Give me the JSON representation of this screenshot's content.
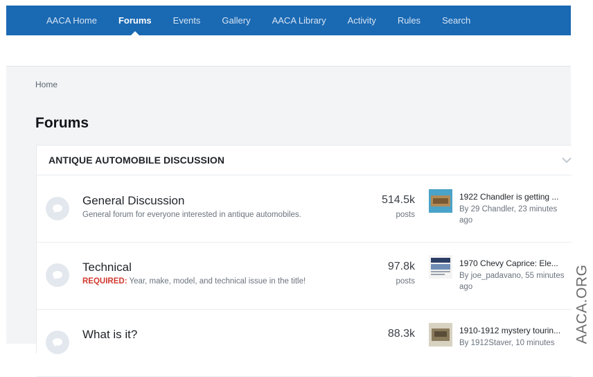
{
  "nav": {
    "items": [
      {
        "label": "AACA Home"
      },
      {
        "label": "Forums",
        "active": true
      },
      {
        "label": "Events"
      },
      {
        "label": "Gallery"
      },
      {
        "label": "AACA Library"
      },
      {
        "label": "Activity"
      },
      {
        "label": "Rules"
      },
      {
        "label": "Search"
      }
    ]
  },
  "breadcrumb": {
    "home": "Home"
  },
  "page_title": "Forums",
  "category": {
    "title": "ANTIQUE AUTOMOBILE DISCUSSION",
    "forums": [
      {
        "name": "General Discussion",
        "description": "General forum for everyone interested in antique automobiles.",
        "count": "514.5k",
        "count_label": "posts",
        "last_post_title": "1922 Chandler is getting ...",
        "last_post_meta": "By 29 Chandler, 23 minutes ago"
      },
      {
        "name": "Technical",
        "required_label": "REQUIRED:",
        "description": "Year, make, model, and technical issue in the title!",
        "count": "97.8k",
        "count_label": "posts",
        "last_post_title": "1970 Chevy Caprice: Ele...",
        "last_post_meta": "By joe_padavano, 55 minutes ago"
      },
      {
        "name": "What is it?",
        "count": "88.3k",
        "last_post_title": "1910-1912 mystery tourin...",
        "last_post_meta": "By 1912Staver, 10 minutes"
      }
    ]
  },
  "watermark": "AACA.ORG",
  "colors": {
    "nav_bg": "#1a69b3",
    "required": "#d13a2f",
    "page_bg": "#f2f4f6"
  }
}
